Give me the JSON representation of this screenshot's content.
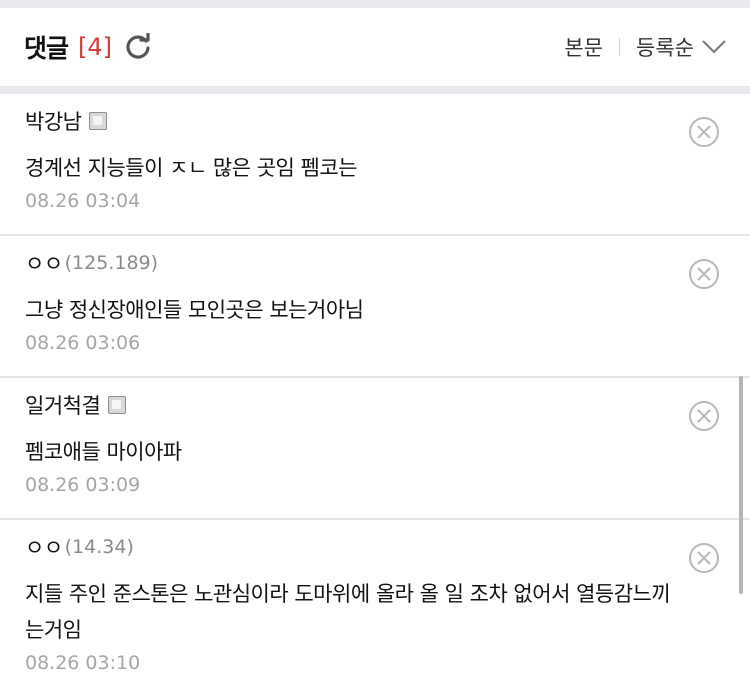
{
  "header": {
    "title": "댓글",
    "count": "[4]",
    "refresh_icon": "refresh-icon",
    "view_label": "본문",
    "sort_label": "등록순",
    "sort_icon": "chevron-down-icon"
  },
  "comments": [
    {
      "author": "박강남",
      "ip": "",
      "text": "경계선 지능들이 ㅈㄴ 많은 곳임 펨코는",
      "time": "08.26 03:04",
      "badge": true
    },
    {
      "author": "ㅇㅇ",
      "ip": "(125.189)",
      "text": "그냥 정신장애인들 모인곳은 보는거아님",
      "time": "08.26 03:06",
      "badge": false
    },
    {
      "author": "일거척결",
      "ip": "",
      "text": "펨코애들 마이아파",
      "time": "08.26 03:09",
      "badge": true
    },
    {
      "author": "ㅇㅇ",
      "ip": "(14.34)",
      "text": "지들 주인 준스톤은 노관심이라 도마위에 올라 올 일 조차 없어서 열등감느끼는거임",
      "time": "08.26 03:10",
      "badge": false
    }
  ],
  "colors": {
    "accent_count": "#d63a3a",
    "time": "#a5a5a5",
    "divider": "#e9e9ee"
  }
}
